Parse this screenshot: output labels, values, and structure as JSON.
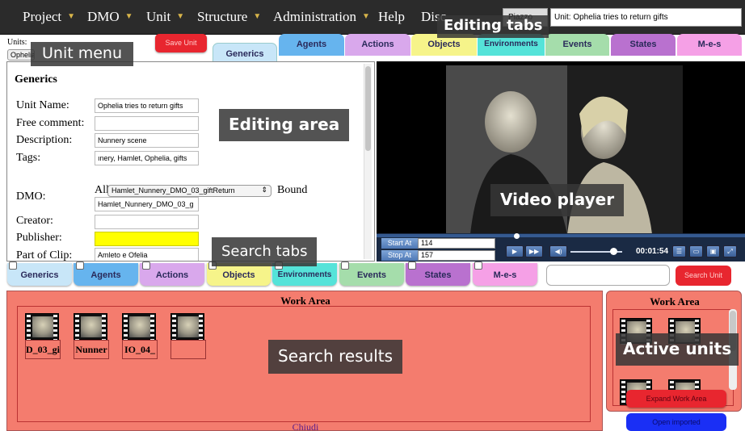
{
  "menubar": {
    "items": [
      {
        "label": "Project",
        "has_chevron": true
      },
      {
        "label": "DMO",
        "has_chevron": true
      },
      {
        "label": "Unit",
        "has_chevron": true
      },
      {
        "label": "Structure",
        "has_chevron": true
      },
      {
        "label": "Administration",
        "has_chevron": true
      },
      {
        "label": "Help",
        "has_chevron": false
      },
      {
        "label": "Disc",
        "has_chevron": false
      }
    ],
    "partial_field_value": "Piazzo",
    "unit_field_value": "Unit: Ophelia tries to return gifts",
    "chevron_color": "#d8b54a"
  },
  "callouts": {
    "editing_tabs": "Editing tabs",
    "unit_menu": "Unit menu",
    "editing_area": "Editing area",
    "video_player": "Video player",
    "search_tabs": "Search tabs",
    "search_results": "Search results",
    "active_units": "Active units"
  },
  "unit_bar": {
    "units_label": "Units:",
    "unit_select_value": "Ophelia",
    "save_unit": "Save Unit"
  },
  "editing_tabs": [
    {
      "label": "Generics",
      "color": "#c8e6f8",
      "active": true
    },
    {
      "label": "Agents",
      "color": "#66b4ee"
    },
    {
      "label": "Actions",
      "color": "#d9a8ec"
    },
    {
      "label": "Objects",
      "color": "#f6f48a"
    },
    {
      "label": "Environments",
      "color": "#55e3d9"
    },
    {
      "label": "Events",
      "color": "#a5ddab"
    },
    {
      "label": "States",
      "color": "#b971cf"
    },
    {
      "label": "M-e-s",
      "color": "#f5a0e6"
    }
  ],
  "editing_area": {
    "heading": "Generics",
    "fields": {
      "unit_name": {
        "label": "Unit Name:",
        "value": "Ophelia tries to return gifts"
      },
      "free_comment": {
        "label": "Free comment:",
        "value": ""
      },
      "description": {
        "label": "Description:",
        "value": "Nunnery scene"
      },
      "tags": {
        "label": "Tags:",
        "value": "ınery, Hamlet, Ophelia, gifts"
      },
      "dmo": {
        "label": "DMO:",
        "prefix": "All",
        "select_value": "Hamlet_Nunnery_DMO_03_giftReturn",
        "bound_label": "Bound",
        "value": "Hamlet_Nunnery_DMO_03_g"
      },
      "creator": {
        "label": "Creator:",
        "value": ""
      },
      "publisher": {
        "label": "Publisher:",
        "value": "",
        "highlight": "#ffff00"
      },
      "part_of_clip": {
        "label": "Part of Clip:",
        "value": "Amleto e Ofelia"
      }
    }
  },
  "video": {
    "start_label": "Start At",
    "start_value": "114",
    "stop_label": "Stop At",
    "stop_value": "157",
    "time": "00:01:54",
    "volume_level": 0.8
  },
  "search_tabs": [
    {
      "label": "Generics",
      "color": "#c8e6f8"
    },
    {
      "label": "Agents",
      "color": "#66b4ee"
    },
    {
      "label": "Actions",
      "color": "#d9a8ec"
    },
    {
      "label": "Objects",
      "color": "#f6f48a"
    },
    {
      "label": "Environments",
      "color": "#55e3d9"
    },
    {
      "label": "Events",
      "color": "#a5ddab"
    },
    {
      "label": "States",
      "color": "#b971cf"
    },
    {
      "label": "M-e-s",
      "color": "#f5a0e6"
    }
  ],
  "search": {
    "button": "Search Unit",
    "query": ""
  },
  "work_area": {
    "title": "Work Area",
    "results": [
      {
        "label": "D_03_gi"
      },
      {
        "label": "Nunner"
      },
      {
        "label": "IO_04_"
      },
      {
        "label": ""
      }
    ],
    "close_link": "Chiudi",
    "background": "#f47c6e"
  },
  "active_units": {
    "title": "Work Area",
    "expand_button": "Expand Work Area",
    "open_imported_button": "Open imported"
  }
}
